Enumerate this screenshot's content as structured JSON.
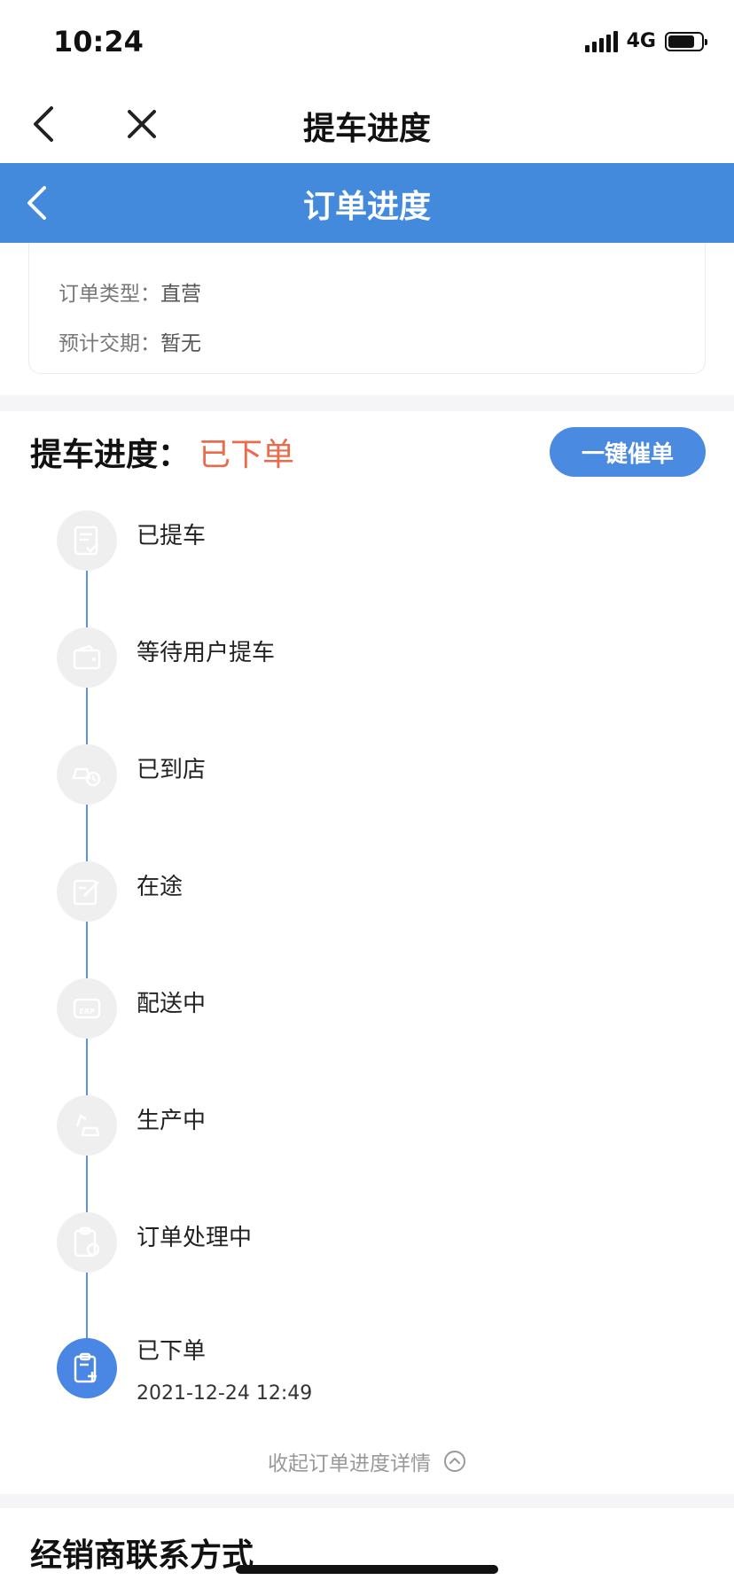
{
  "status_bar": {
    "time": "10:24",
    "network": "4G",
    "battery_level": 0.8
  },
  "nav": {
    "title": "提车进度"
  },
  "header": {
    "title": "订单进度"
  },
  "order_info": {
    "order_type_label": "订单类型：",
    "order_type_value": "直营",
    "delivery_label": "预计交期：",
    "delivery_value": "暂无"
  },
  "progress": {
    "label": "提车进度：",
    "current_status": "已下单",
    "urge_button": "一键催单",
    "steps": [
      {
        "label": "已提车",
        "icon": "document-check-icon"
      },
      {
        "label": "等待用户提车",
        "icon": "wallet-icon"
      },
      {
        "label": "已到店",
        "icon": "car-clock-icon"
      },
      {
        "label": "在途",
        "icon": "edit-document-icon"
      },
      {
        "label": "配送中",
        "icon": "erp-truck-icon"
      },
      {
        "label": "生产中",
        "icon": "robot-arm-car-icon"
      },
      {
        "label": "订单处理中",
        "icon": "clipboard-clock-icon"
      },
      {
        "label": "已下单",
        "icon": "clipboard-plus-icon",
        "time": "2021-12-24 12:49",
        "active": true
      }
    ],
    "collapse_label": "收起订单进度详情"
  },
  "dealer": {
    "title": "经销商联系方式"
  },
  "colors": {
    "primary": "#4389dc",
    "status_red": "#ec6a4a",
    "line_blue": "#5b93e0"
  }
}
